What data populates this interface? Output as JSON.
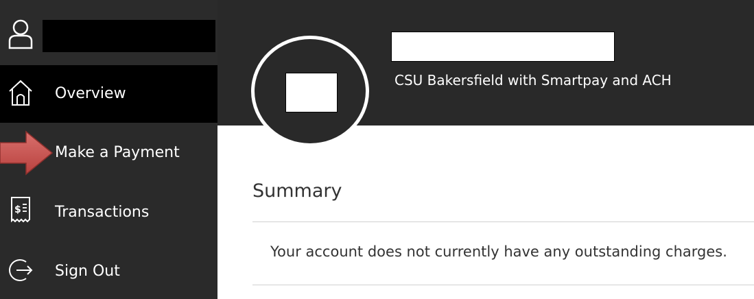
{
  "sidebar": {
    "user_icon": "user-icon",
    "items": [
      {
        "label": "Overview",
        "icon": "home-icon",
        "active": true
      },
      {
        "label": "Make a Payment",
        "icon": "payment-icon",
        "active": false
      },
      {
        "label": "Transactions",
        "icon": "receipt-icon",
        "active": false
      },
      {
        "label": "Sign Out",
        "icon": "sign-out-icon",
        "active": false
      }
    ]
  },
  "header": {
    "subtitle": "CSU Bakersfield with Smartpay and ACH"
  },
  "summary": {
    "title": "Summary",
    "message": "Your account does not currently have any outstanding charges."
  },
  "colors": {
    "sidebar_bg": "#2a2a2a",
    "active_bg": "#000000",
    "header_bg": "#292929",
    "arrow": "#c0504d"
  }
}
